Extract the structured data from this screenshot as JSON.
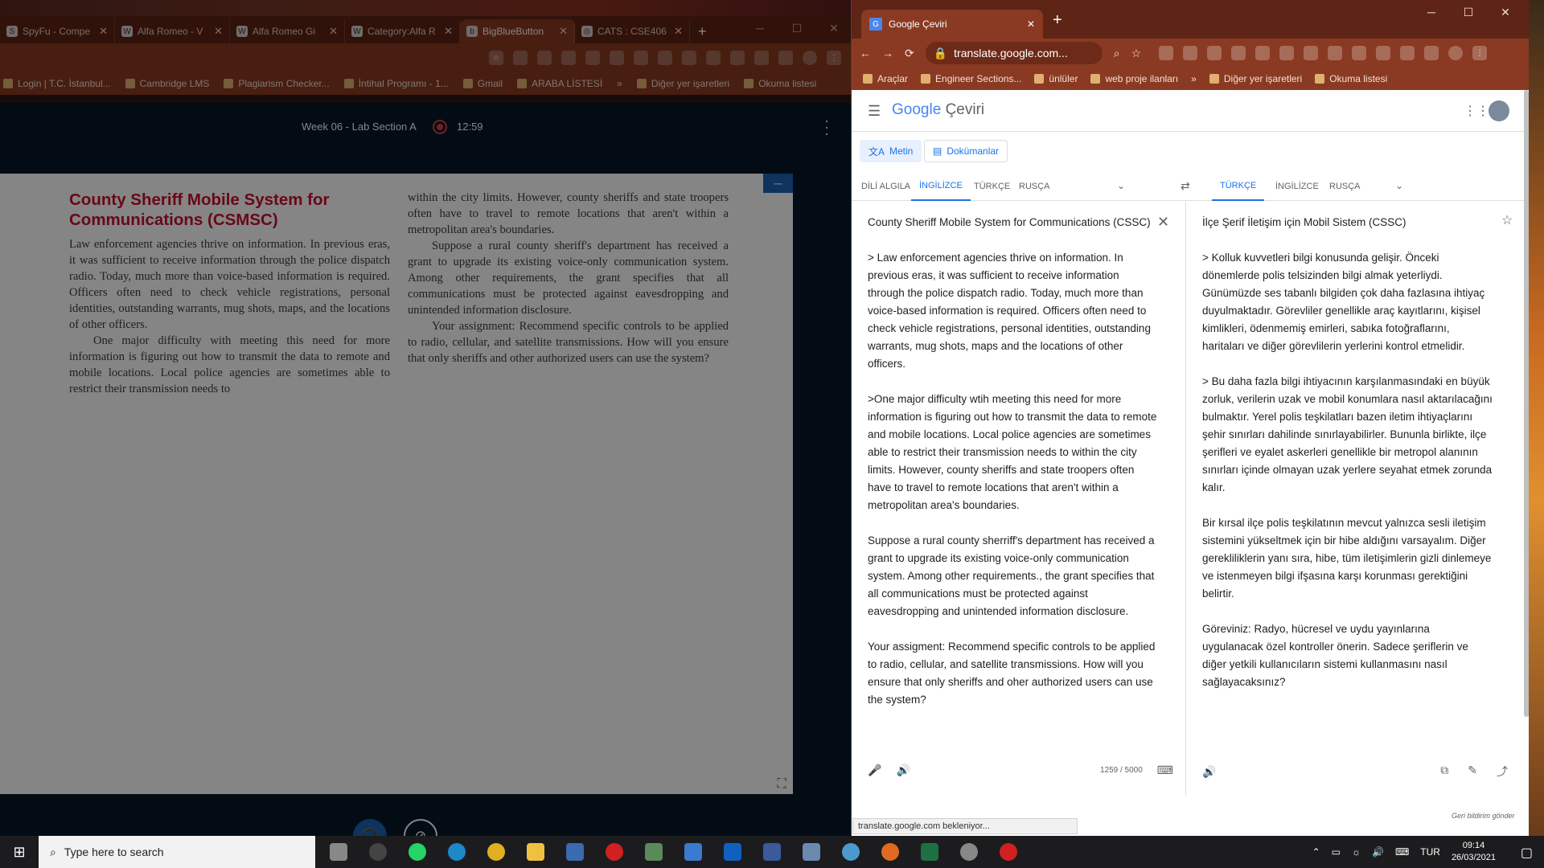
{
  "left_window": {
    "tabs": [
      {
        "title": "SpyFu - Compe",
        "favicon": "S"
      },
      {
        "title": "Alfa Romeo - V",
        "favicon": "W"
      },
      {
        "title": "Alfa Romeo Gi",
        "favicon": "W"
      },
      {
        "title": "Category:Alfa R",
        "favicon": "W"
      },
      {
        "title": "BigBlueButton",
        "favicon": "b"
      },
      {
        "title": "CATS : CSE406",
        "favicon": "◎"
      }
    ],
    "new_tab": "+",
    "bookmarks": [
      "Login | T.C. İstanbul...",
      "Cambridge LMS",
      "Plagiarism Checker...",
      "İntihal Programı - 1...",
      "Gmail",
      "ARABA LİSTESİ",
      "»",
      "Diğer yer işaretleri",
      "Okuma listesi"
    ],
    "meeting": {
      "title": "Week 06 - Lab Section A",
      "recording_time": "12:59"
    },
    "document": {
      "heading": "County Sheriff Mobile System for Communications (CSMSC)",
      "col1_p1": "Law enforcement agencies thrive on information. In previous eras, it was sufficient to receive information through the police dispatch radio. Today, much more than voice-based information is required. Officers often need to check vehicle registrations, personal identities, outstanding warrants, mug shots, maps, and the locations of other officers.",
      "col1_p2": "One major difficulty with meeting this need for more information is figuring out how to transmit the data to remote and mobile locations. Local police agencies are sometimes able to restrict their transmission needs to",
      "col2_p1": "within the city limits. However, county sheriffs and state troopers often have to travel to remote locations that aren't within a metropolitan area's boundaries.",
      "col2_p2": "Suppose a rural county sheriff's department has received a grant to upgrade its existing voice-only communication system. Among other requirements, the grant specifies that all communications must be protected against eavesdropping and unintended information disclosure.",
      "col2_p3": "Your assignment: Recommend specific controls to be applied to radio, cellular, and satellite transmissions. How will you ensure that only sheriffs and other authorized users can use the system?"
    }
  },
  "right_window": {
    "tab_title": "Google Çeviri",
    "address": "translate.google.com...",
    "bookmarks": [
      "Araçlar",
      "Engineer Sections...",
      "ünlüler",
      "web proje ilanları",
      "»",
      "Diğer yer işaretleri",
      "Okuma listesi"
    ],
    "logo_google": "Google",
    "logo_product": "Çeviri",
    "mode_text": "Metin",
    "mode_docs": "Dokümanlar",
    "source_langs": [
      "DİLİ ALGILA",
      "İNGİLİZCE",
      "TÜRKÇE",
      "RUSÇA"
    ],
    "target_langs": [
      "TÜRKÇE",
      "İNGİLİZCE",
      "RUSÇA"
    ],
    "source_text": "County Sheriff Mobile System for Communications (CSSC)\n\n> Law enforcement agencies thrive on information. In previous eras, it was sufficient to receive information through the police dispatch radio. Today, much more than voice-based information is required. Officers often need to check vehicle registrations, personal identities, outstanding warrants, mug shots, maps and the locations of other officers.\n\n>One major difficulty wtih meeting this need for more information is figuring out how to transmit the data to remote and mobile locations. Local police agencies are sometimes able to restrict their transmission needs to within the city limits. However, county sheriffs and state troopers often have to travel to remote locations that aren't within a metropolitan area's boundaries.\n\nSuppose a rural county sherriff's department has received a grant to upgrade its existing voice-only communication system. Among other requirements., the grant specifies that all communications must be protected against eavesdropping and unintended information disclosure.\n\nYour assigment: Recommend specific controls to be applied to radio, cellular, and satellite transmissions. How will you ensure that only sheriffs and oher authorized users can use the system?",
    "target_text": "İlçe Şerif İletişim için Mobil Sistem (CSSC)\n\n> Kolluk kuvvetleri bilgi konusunda gelişir. Önceki dönemlerde polis telsizinden bilgi almak yeterliydi. Günümüzde ses tabanlı bilgiden çok daha fazlasına ihtiyaç duyulmaktadır. Görevliler genellikle araç kayıtlarını, kişisel kimlikleri, ödenmemiş emirleri, sabıka fotoğraflarını, haritaları ve diğer görevlilerin yerlerini kontrol etmelidir.\n\n> Bu daha fazla bilgi ihtiyacının karşılanmasındaki en büyük zorluk, verilerin uzak ve mobil konumlara nasıl aktarılacağını bulmaktır. Yerel polis teşkilatları bazen iletim ihtiyaçlarını şehir sınırları dahilinde sınırlayabilirler. Bununla birlikte, ilçe şerifleri ve eyalet askerleri genellikle bir metropol alanının sınırları içinde olmayan uzak yerlere seyahat etmek zorunda kalır.\n\nBir kırsal ilçe polis teşkilatının mevcut yalnızca sesli iletişim sistemini yükseltmek için bir hibe aldığını varsayalım. Diğer gerekliliklerin yanı sıra, hibe, tüm iletişimlerin gizli dinlemeye ve istenmeyen bilgi ifşasına karşı korunması gerektiğini belirtir.\n\nGöreviniz: Radyo, hücresel ve uydu yayınlarına uygulanacak özel kontroller önerin. Sadece şeriflerin ve diğer yetkili kullanıcıların sistemi kullanmasını nasıl sağlayacaksınız?",
    "char_count": "1259 / 5000",
    "feedback": "Geri bildirim gönder",
    "status": "translate.google.com bekleniyor..."
  },
  "taskbar": {
    "search_placeholder": "Type here to search",
    "lang": "TUR",
    "time": "09:14",
    "date": "26/03/2021"
  }
}
